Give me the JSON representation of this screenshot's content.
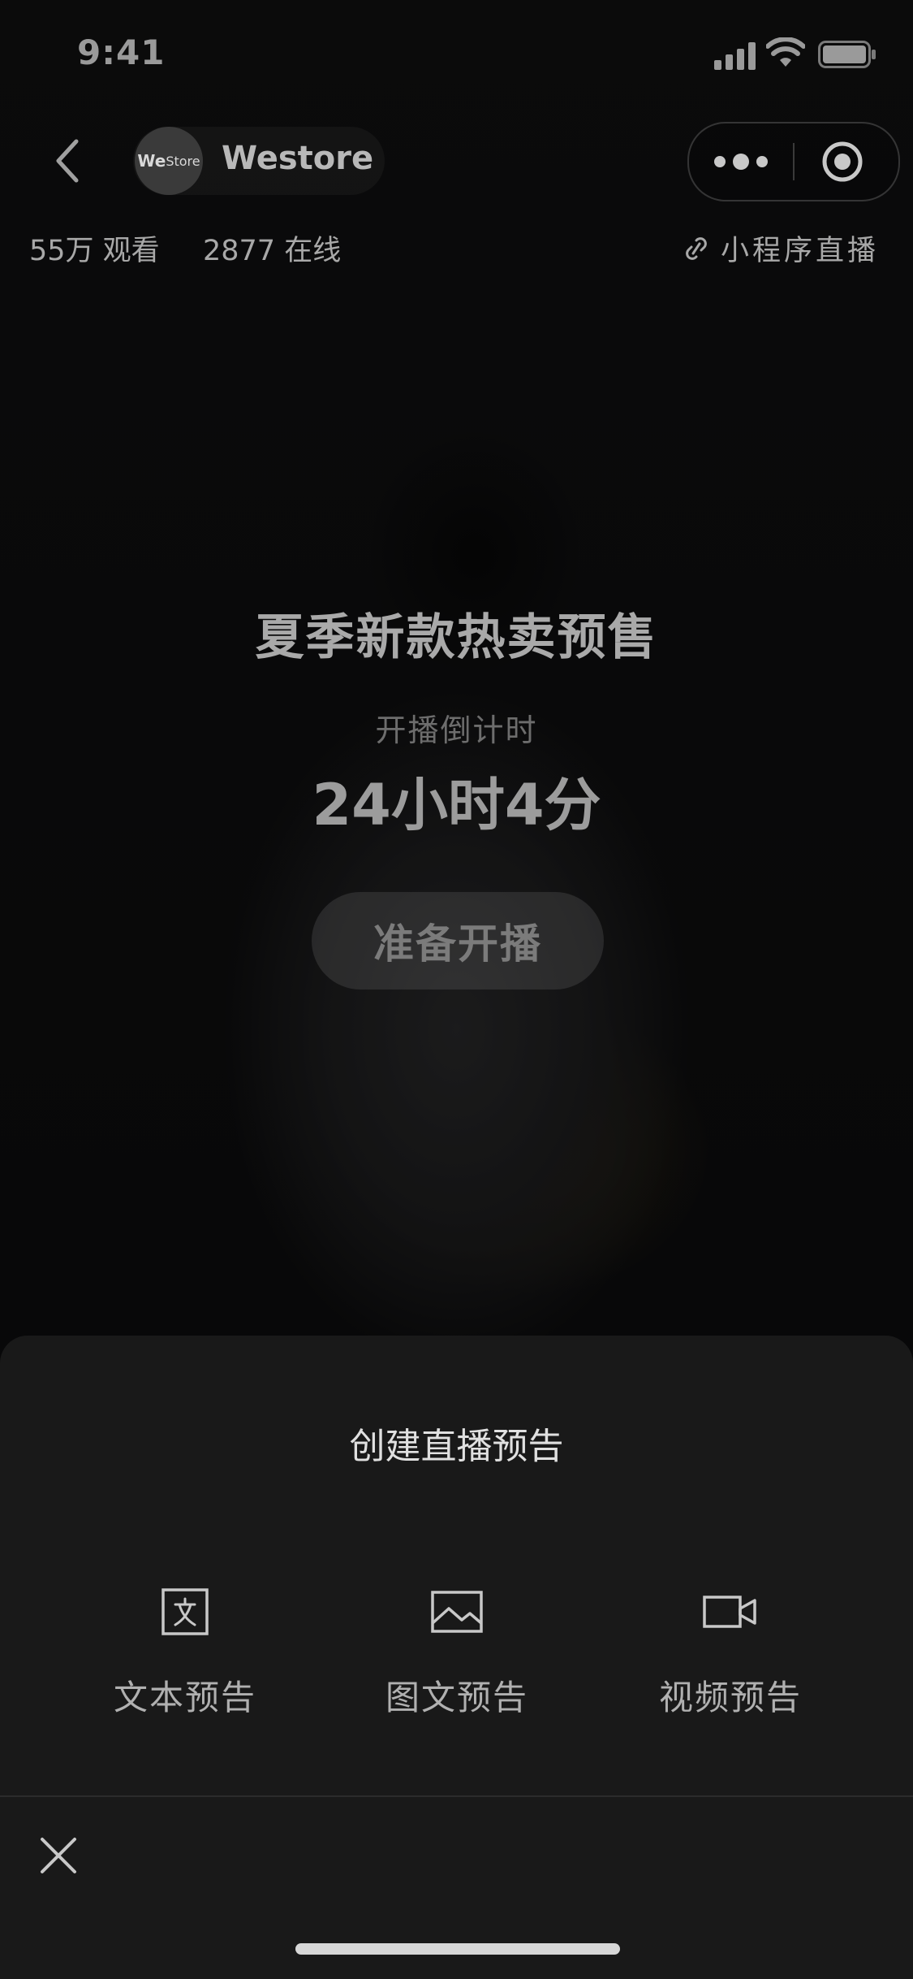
{
  "status_bar": {
    "time": "9:41"
  },
  "header": {
    "shop_name": "Westore",
    "avatar_text_bold": "We",
    "avatar_text": "Store",
    "views": "55万 观看",
    "online": "2877 在线",
    "miniprogram_live": "小程序直播"
  },
  "live": {
    "title": "夏季新款热卖预售",
    "countdown_label": "开播倒计时",
    "countdown_value": "24小时4分",
    "prepare_button": "准备开播"
  },
  "sheet": {
    "title": "创建直播预告",
    "options": [
      {
        "label": "文本预告",
        "icon": "text-doc-icon"
      },
      {
        "label": "图文预告",
        "icon": "image-icon"
      },
      {
        "label": "视频预告",
        "icon": "video-icon"
      }
    ]
  }
}
